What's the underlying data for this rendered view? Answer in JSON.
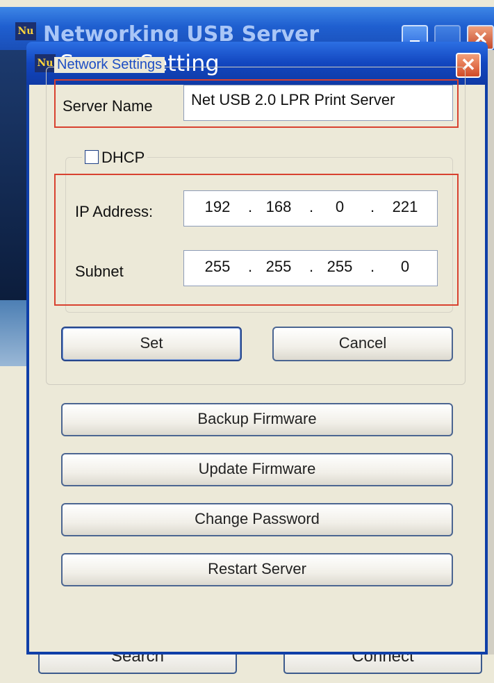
{
  "main_window": {
    "title": "Networking USB Server",
    "icon": "Nu",
    "buttons": {
      "search": "Search",
      "connect": "Connect"
    }
  },
  "dialog": {
    "title": "Server Setting",
    "icon": "Nu",
    "group_label": "Network Settings",
    "server_name": {
      "label": "Server Name",
      "value": "Net USB 2.0 LPR Print Server"
    },
    "dhcp": {
      "label": "DHCP",
      "checked": false
    },
    "ip_address": {
      "label": "IP Address:",
      "octets": [
        "192",
        "168",
        "0",
        "221"
      ]
    },
    "subnet": {
      "label": "Subnet",
      "octets": [
        "255",
        "255",
        "255",
        "0"
      ]
    },
    "buttons": {
      "set": "Set",
      "cancel": "Cancel",
      "backup_firmware": "Backup Firmware",
      "update_firmware": "Update Firmware",
      "change_password": "Change Password",
      "restart_server": "Restart Server"
    },
    "highlight_color": "#d8412f"
  }
}
